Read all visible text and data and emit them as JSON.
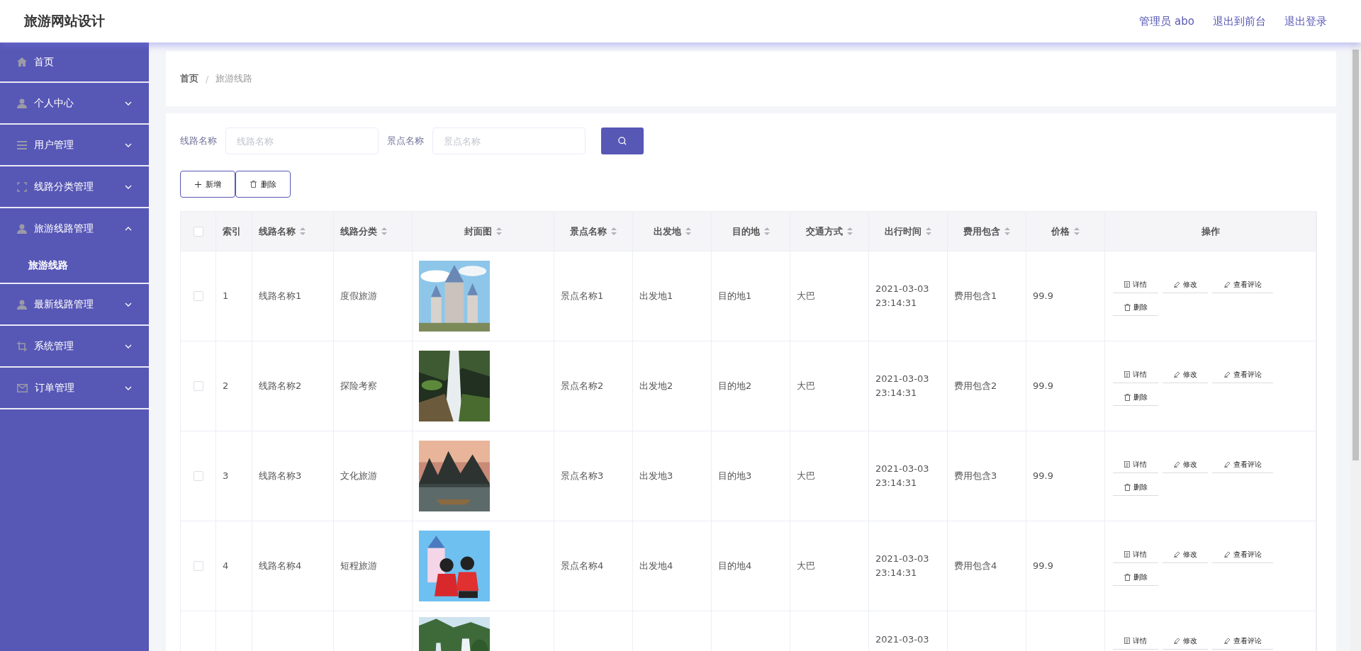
{
  "header": {
    "title": "旅游网站设计",
    "links": [
      "管理员 abo",
      "退出到前台",
      "退出登录"
    ]
  },
  "sidebar": {
    "items": [
      {
        "label": "首页",
        "kind": "link"
      },
      {
        "label": "个人中心",
        "kind": "menu",
        "expanded": false
      },
      {
        "label": "用户管理",
        "kind": "menu",
        "expanded": false
      },
      {
        "label": "线路分类管理",
        "kind": "menu",
        "expanded": false
      },
      {
        "label": "旅游线路管理",
        "kind": "menu",
        "expanded": true,
        "children": [
          {
            "label": "旅游线路"
          }
        ]
      },
      {
        "label": "最新线路管理",
        "kind": "menu",
        "expanded": false
      },
      {
        "label": "系统管理",
        "kind": "menu",
        "expanded": false
      },
      {
        "label": "订单管理",
        "kind": "menu",
        "expanded": false
      }
    ]
  },
  "breadcrumb": {
    "items": [
      "首页",
      "旅游线路"
    ],
    "separator": "/"
  },
  "search": {
    "fields": [
      {
        "label": "线路名称",
        "placeholder": "线路名称"
      },
      {
        "label": "景点名称",
        "placeholder": "景点名称"
      }
    ]
  },
  "toolbar": [
    {
      "label": "新增",
      "kind": "add"
    },
    {
      "label": "删除",
      "kind": "delete"
    }
  ],
  "table": {
    "select_all": {
      "checked": false
    },
    "columns": [
      {
        "label": "索引",
        "sortable": false
      },
      {
        "label": "线路名称",
        "sortable": true
      },
      {
        "label": "线路分类",
        "sortable": true
      },
      {
        "label": "封面图",
        "sortable": true
      },
      {
        "label": "景点名称",
        "sortable": true
      },
      {
        "label": "出发地",
        "sortable": true
      },
      {
        "label": "目的地",
        "sortable": true
      },
      {
        "label": "交通方式",
        "sortable": true
      },
      {
        "label": "出行时间",
        "sortable": true
      },
      {
        "label": "费用包含",
        "sortable": true
      },
      {
        "label": "价格",
        "sortable": true
      },
      {
        "label": "操作",
        "sortable": false
      }
    ],
    "rows": [
      {
        "checked": false,
        "cells": [
          "1",
          "线路名称1",
          "度假旅游",
          null,
          "景点名称1",
          "出发地1",
          "目的地1",
          "大巴",
          "2021-03-03 23:14:31",
          "费用包含1",
          "99.9"
        ],
        "cover": {
          "kind": "picture"
        },
        "actions": [
          {
            "label": "详情",
            "kind": "detail"
          },
          {
            "label": "修改",
            "kind": "edit"
          },
          {
            "label": "查看评论",
            "kind": "edit"
          },
          {
            "label": "删除",
            "kind": "delete"
          }
        ]
      },
      {
        "checked": false,
        "cells": [
          "2",
          "线路名称2",
          "探险考察",
          null,
          "景点名称2",
          "出发地2",
          "目的地2",
          "大巴",
          "2021-03-03 23:14:31",
          "费用包含2",
          "99.9"
        ],
        "cover": {
          "kind": "picture"
        },
        "actions": [
          {
            "label": "详情",
            "kind": "detail"
          },
          {
            "label": "修改",
            "kind": "edit"
          },
          {
            "label": "查看评论",
            "kind": "edit"
          },
          {
            "label": "删除",
            "kind": "delete"
          }
        ]
      },
      {
        "checked": false,
        "cells": [
          "3",
          "线路名称3",
          "文化旅游",
          null,
          "景点名称3",
          "出发地3",
          "目的地3",
          "大巴",
          "2021-03-03 23:14:31",
          "费用包含3",
          "99.9"
        ],
        "cover": {
          "kind": "picture"
        },
        "actions": [
          {
            "label": "详情",
            "kind": "detail"
          },
          {
            "label": "修改",
            "kind": "edit"
          },
          {
            "label": "查看评论",
            "kind": "edit"
          },
          {
            "label": "删除",
            "kind": "delete"
          }
        ]
      },
      {
        "checked": false,
        "cells": [
          "4",
          "线路名称4",
          "短程旅游",
          null,
          "景点名称4",
          "出发地4",
          "目的地4",
          "大巴",
          "2021-03-03 23:14:31",
          "费用包含4",
          "99.9"
        ],
        "cover": {
          "kind": "picture"
        },
        "actions": [
          {
            "label": "详情",
            "kind": "detail"
          },
          {
            "label": "修改",
            "kind": "edit"
          },
          {
            "label": "查看评论",
            "kind": "edit"
          },
          {
            "label": "删除",
            "kind": "delete"
          }
        ]
      },
      {
        "cells": [
          null,
          null,
          null,
          null,
          null,
          null,
          null,
          null,
          "2021-03-03",
          null,
          null
        ],
        "cover": {
          "kind": "picture"
        },
        "actions": [
          {
            "label": "详情",
            "kind": "detail"
          },
          {
            "label": "修改",
            "kind": "edit"
          },
          {
            "label": "查看评论",
            "kind": "edit"
          }
        ]
      }
    ]
  }
}
